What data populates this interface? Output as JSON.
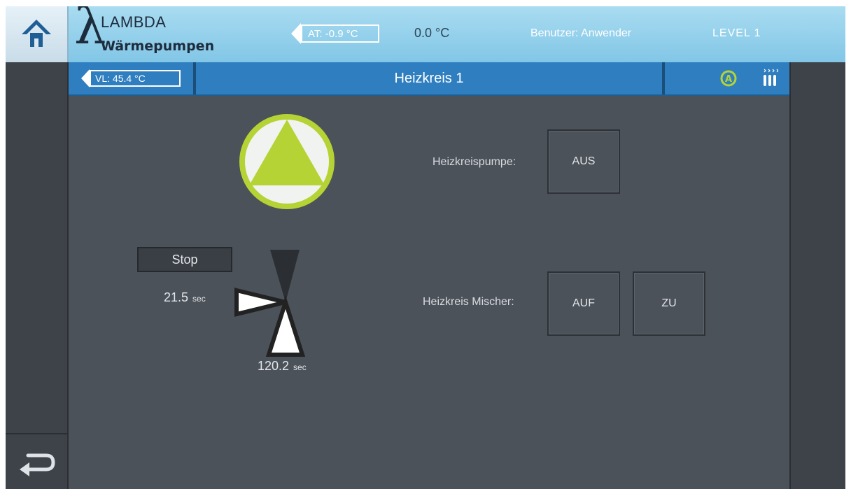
{
  "header": {
    "brand_line1": "LAMBDA",
    "brand_line2": "Wärmepumpen",
    "outdoor_temp": "AT: -0.9 °C",
    "second_temp": "0.0 °C",
    "user": "Benutzer: Anwender",
    "level": "LEVEL  1"
  },
  "titlebar": {
    "flow_temp": "VL: 45.4 °C",
    "title": "Heizkreis 1"
  },
  "icons": {
    "home": "home-icon",
    "back": "back-arrow-icon",
    "auto_mode": "auto-mode-icon",
    "heating": "heating-icon",
    "pump": "pump-icon",
    "valve": "mixing-valve-icon"
  },
  "main": {
    "pump_label": "Heizkreispumpe:",
    "pump_state": "AUS",
    "mixer_label": "Heizkreis Mischer:",
    "mixer_open": "AUF",
    "mixer_close": "ZU",
    "stop_label": "Stop",
    "valve_time_left": "21.5",
    "valve_time_bottom": "120.2",
    "unit": "sec"
  },
  "colors": {
    "header_gradient_top": "#a9dcf1",
    "titlebar_blue": "#2f7fc0",
    "background": "#4c525a",
    "accent_green": "#b5d334"
  }
}
